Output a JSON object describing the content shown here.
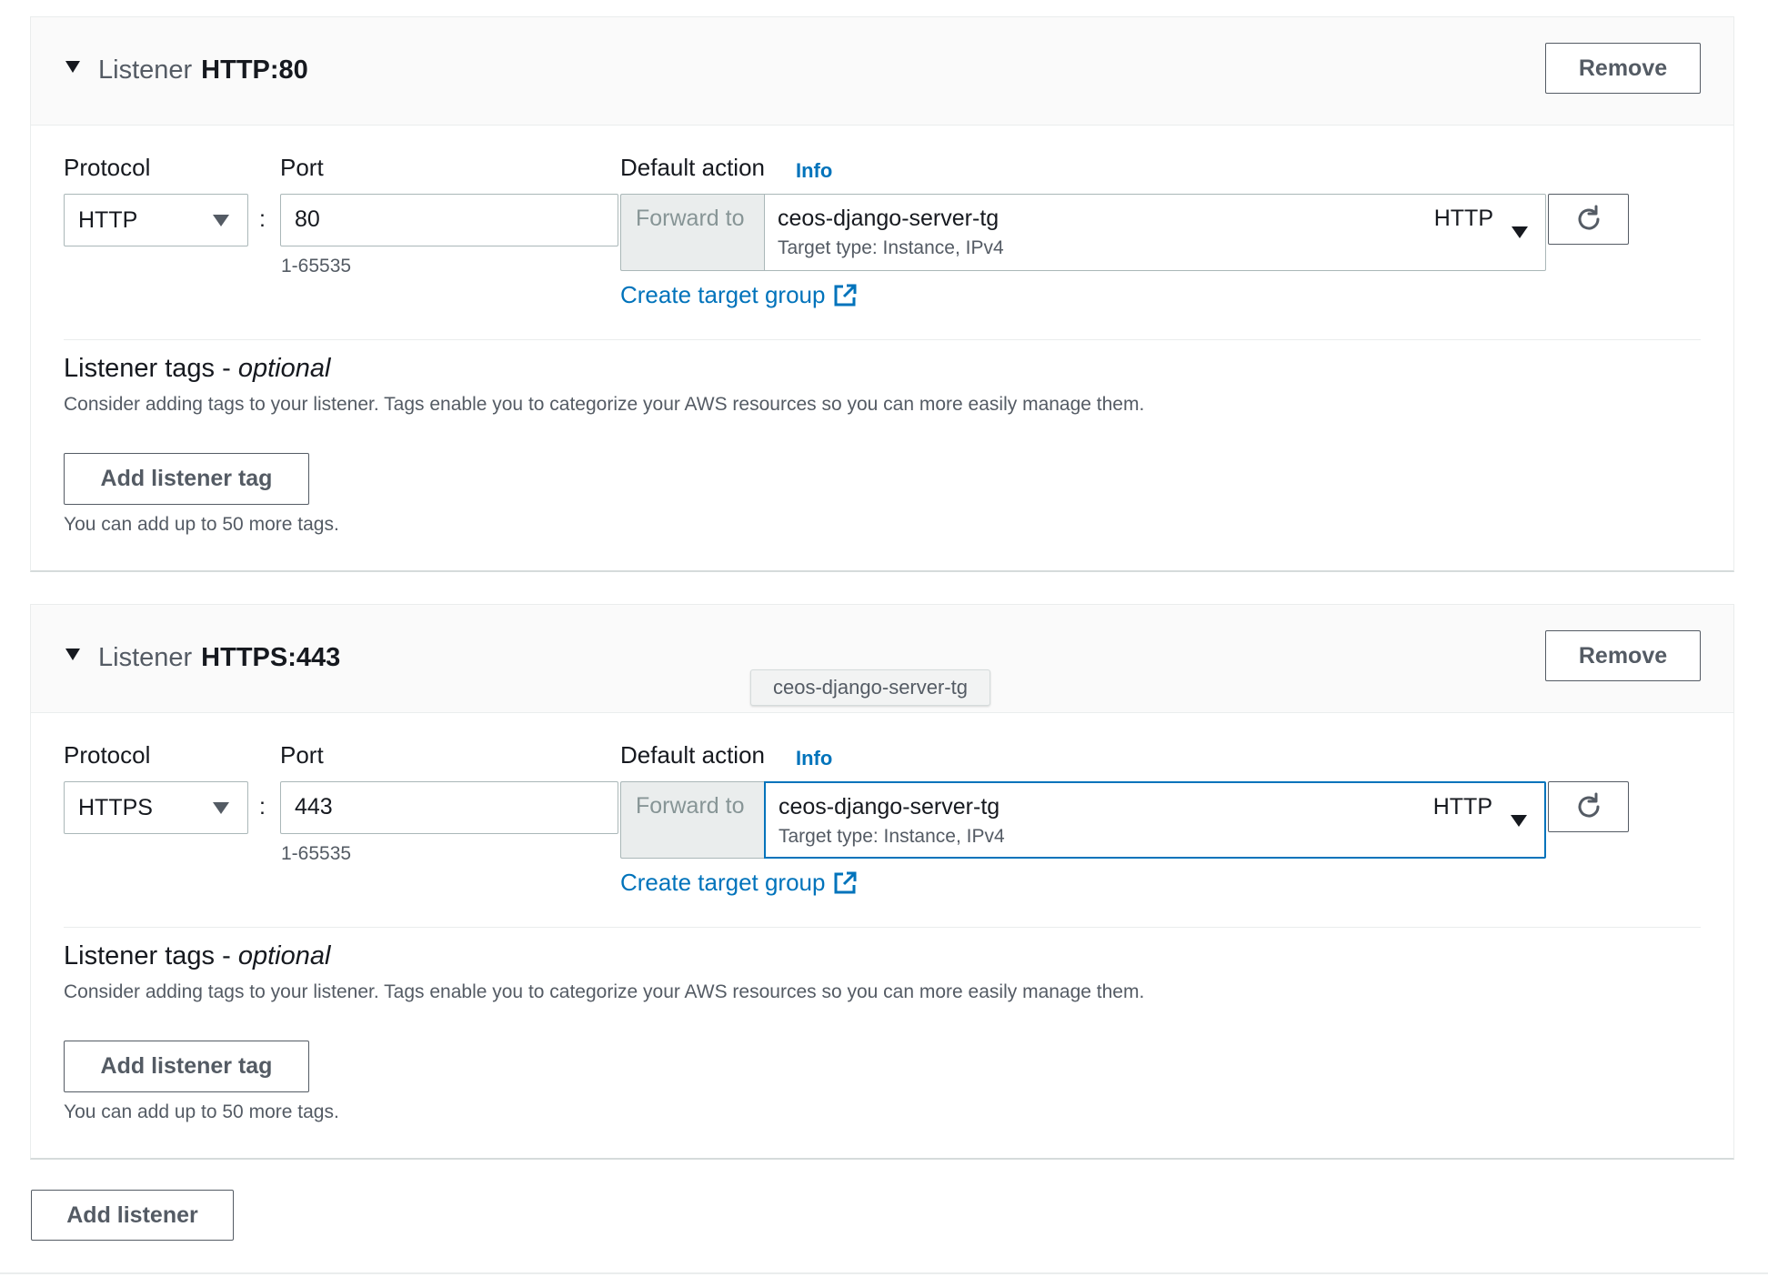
{
  "listeners": [
    {
      "title_prefix": "Listener",
      "title_value": "HTTP:80",
      "remove_label": "Remove",
      "protocol_label": "Protocol",
      "protocol_value": "HTTP",
      "port_label": "Port",
      "port_value": "80",
      "port_hint": "1-65535",
      "colon": ":",
      "default_action_label": "Default action",
      "info_label": "Info",
      "forward_label": "Forward to",
      "target_group_name": "ceos-django-server-tg",
      "target_type": "Target type: Instance, IPv4",
      "target_protocol": "HTTP",
      "create_target_group_label": "Create target group",
      "tags_title": "Listener tags - ",
      "tags_title_optional": "optional",
      "tags_description": "Consider adding tags to your listener. Tags enable you to categorize your AWS resources so you can more easily manage them.",
      "add_tag_label": "Add listener tag",
      "tags_limit": "You can add up to 50 more tags."
    },
    {
      "title_prefix": "Listener",
      "title_value": "HTTPS:443",
      "remove_label": "Remove",
      "protocol_label": "Protocol",
      "protocol_value": "HTTPS",
      "port_label": "Port",
      "port_value": "443",
      "port_hint": "1-65535",
      "colon": ":",
      "default_action_label": "Default action",
      "info_label": "Info",
      "forward_label": "Forward to",
      "target_group_name": "ceos-django-server-tg",
      "target_type": "Target type: Instance, IPv4",
      "target_protocol": "HTTP",
      "create_target_group_label": "Create target group",
      "tags_title": "Listener tags - ",
      "tags_title_optional": "optional",
      "tags_description": "Consider adding tags to your listener. Tags enable you to categorize your AWS resources so you can more easily manage them.",
      "add_tag_label": "Add listener tag",
      "tags_limit": "You can add up to 50 more tags."
    }
  ],
  "tooltip": {
    "text": "ceos-django-server-tg"
  },
  "add_listener_label": "Add listener",
  "colors": {
    "link": "#0073bb",
    "focus_border": "#0073bb",
    "text_primary": "#16191f",
    "text_secondary": "#545b64",
    "header_bg": "#fafafa"
  },
  "icons": {
    "collapse": "caret-down-icon",
    "dropdown": "triangle-down-icon",
    "refresh": "refresh-icon",
    "external_link": "external-link-icon"
  }
}
